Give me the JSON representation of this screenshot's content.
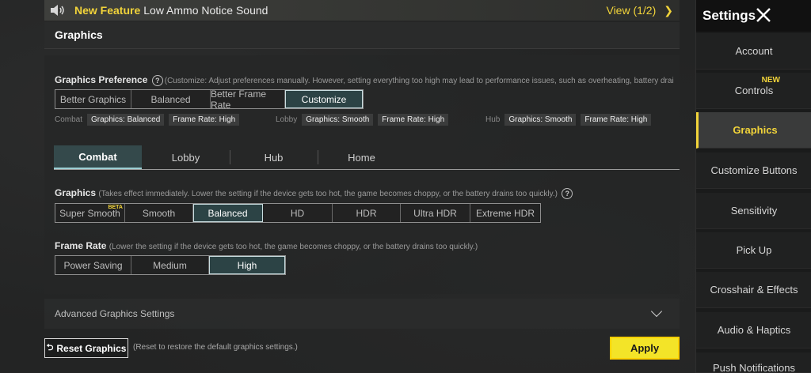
{
  "notice": {
    "tag": "New Feature",
    "text": "Low Ammo Notice Sound",
    "view_label": "View (1/2)"
  },
  "page_title": "Graphics",
  "preference": {
    "label": "Graphics Preference",
    "note": "(Customize: Adjust preferences manually. However, setting everything too high may lead to performance issues, such as overheating, battery drai",
    "options": [
      "Better Graphics",
      "Balanced",
      "Better Frame Rate",
      "Customize"
    ],
    "selected": "Customize"
  },
  "summary": {
    "combat": {
      "label": "Combat",
      "graphics": "Graphics: Balanced",
      "frame_rate": "Frame Rate: High"
    },
    "lobby": {
      "label": "Lobby",
      "graphics": "Graphics: Smooth",
      "frame_rate": "Frame Rate: High"
    },
    "hub": {
      "label": "Hub",
      "graphics": "Graphics: Smooth",
      "frame_rate": "Frame Rate: High"
    }
  },
  "tabs": [
    "Combat",
    "Lobby",
    "Hub",
    "Home"
  ],
  "selected_tab": "Combat",
  "graphics": {
    "label": "Graphics",
    "note": "(Takes effect immediately. Lower the setting if the device gets too hot, the game becomes choppy, or the battery drains too quickly.)",
    "options": [
      "Super Smooth",
      "Smooth",
      "Balanced",
      "HD",
      "HDR",
      "Ultra HDR",
      "Extreme HDR"
    ],
    "beta_badge": "BETA",
    "selected": "Balanced"
  },
  "frame_rate": {
    "label": "Frame Rate",
    "note": "(Lower the setting if the device gets too hot, the game becomes choppy, or the battery drains too quickly.)",
    "options": [
      "Power Saving",
      "Medium",
      "High"
    ],
    "selected": "High"
  },
  "advanced": {
    "label": "Advanced Graphics Settings"
  },
  "reset": {
    "label": "Reset Graphics",
    "note": "(Reset to restore the default graphics settings.)"
  },
  "apply": {
    "label": "Apply"
  },
  "sidebar": {
    "title": "Settings",
    "items": [
      {
        "label": "Account"
      },
      {
        "label": "Controls",
        "badge": "NEW"
      },
      {
        "label": "Graphics"
      },
      {
        "label": "Customize Buttons"
      },
      {
        "label": "Sensitivity"
      },
      {
        "label": "Pick Up"
      },
      {
        "label": "Crosshair & Effects"
      },
      {
        "label": "Audio & Haptics"
      },
      {
        "label": "Push Notifications"
      }
    ],
    "selected": "Graphics"
  },
  "colors": {
    "accent": "#f2d43a",
    "selected_teal": "#2c4345"
  }
}
